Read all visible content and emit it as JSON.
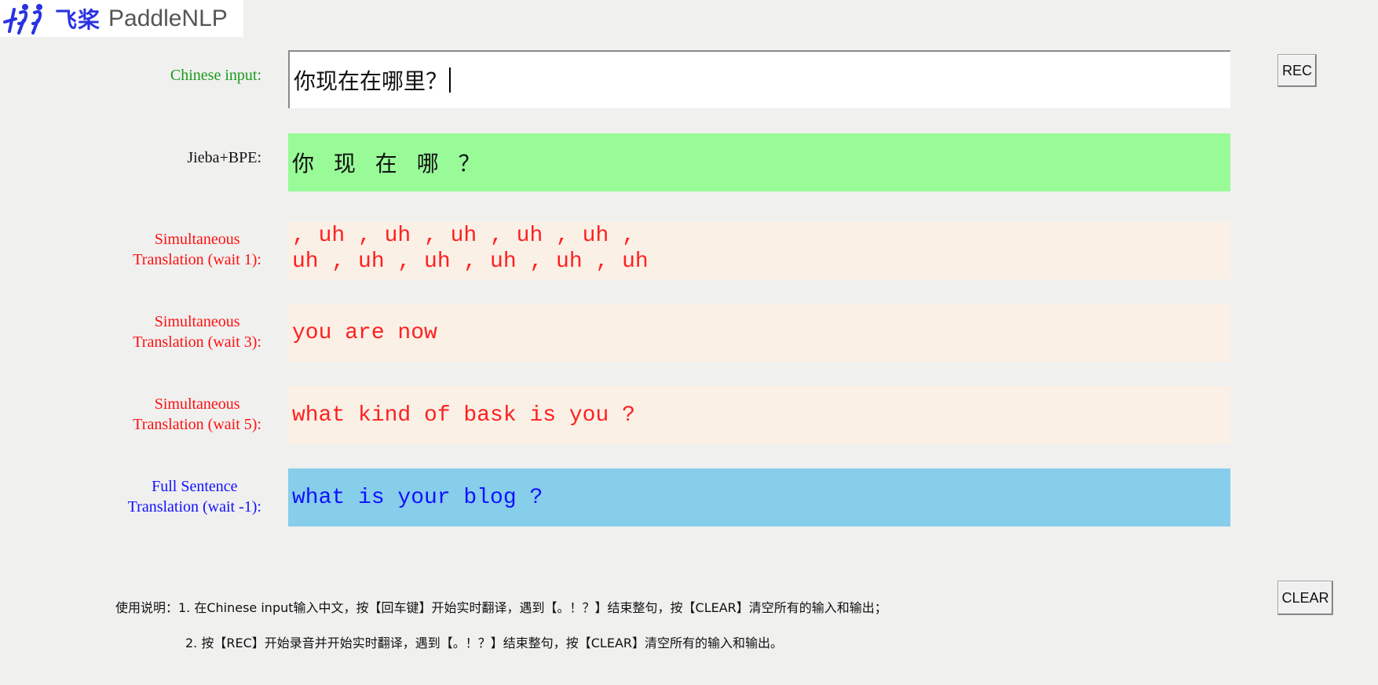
{
  "logo": {
    "cn_text": "飞桨",
    "en_text": "PaddleNLP",
    "brand_color": "#2932e1"
  },
  "rows": {
    "chinese_input": {
      "label": "Chinese input:",
      "value": "你现在在哪里？"
    },
    "jieba_bpe": {
      "label": "Jieba+BPE:",
      "value": "你 现 在 哪 ？"
    },
    "wait1": {
      "label_line1": "Simultaneous",
      "label_line2": "Translation (wait 1):",
      "line1": ", uh , uh , uh , uh , uh ,",
      "line2": "uh , uh , uh , uh , uh , uh"
    },
    "wait3": {
      "label_line1": "Simultaneous",
      "label_line2": "Translation (wait 3):",
      "value": "you are now"
    },
    "wait5": {
      "label_line1": "Simultaneous",
      "label_line2": "Translation (wait 5):",
      "value": "what kind of bask is you ?"
    },
    "full": {
      "label_line1": "Full Sentence",
      "label_line2": "Translation (wait -1):",
      "value": "what is your blog ?"
    }
  },
  "buttons": {
    "rec": "REC",
    "clear": "CLEAR"
  },
  "instructions": {
    "line1": "使用说明：1. 在Chinese input输入中文，按【回车键】开始实时翻译，遇到【。！？】结束整句，按【CLEAR】清空所有的输入和输出；",
    "line2": "2. 按【REC】开始录音并开始实时翻译，遇到【。！？】结束整句，按【CLEAR】清空所有的输入和输出。"
  },
  "colors": {
    "window_bg": "#f0f0ef",
    "segmentation_bg": "#98fb98",
    "simultaneous_bg": "#faf0e6",
    "full_sentence_bg": "#87ceeb",
    "label_green": "#1a9a1a",
    "label_red": "#ff1010",
    "label_blue": "#1010ff"
  }
}
